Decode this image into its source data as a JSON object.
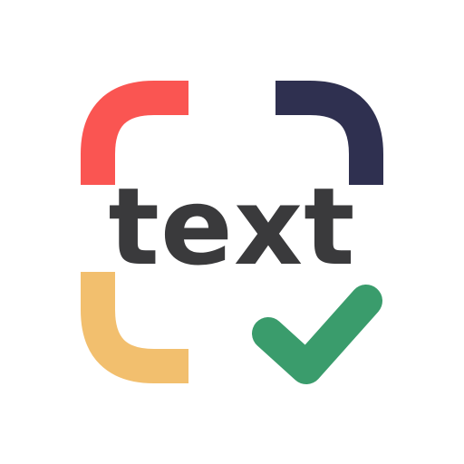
{
  "logo": {
    "wordmark": "text",
    "icon_names": {
      "top_left": "frame-corner-top-left-icon",
      "top_right": "frame-corner-top-right-icon",
      "bottom_left": "frame-corner-bottom-left-icon",
      "check": "checkmark-icon"
    },
    "colors": {
      "top_left": "#fa5552",
      "top_right": "#2f3050",
      "bottom_left": "#f2bf6e",
      "check": "#3a9c6c",
      "text": "#3a3a3c",
      "background": "#ffffff"
    }
  }
}
